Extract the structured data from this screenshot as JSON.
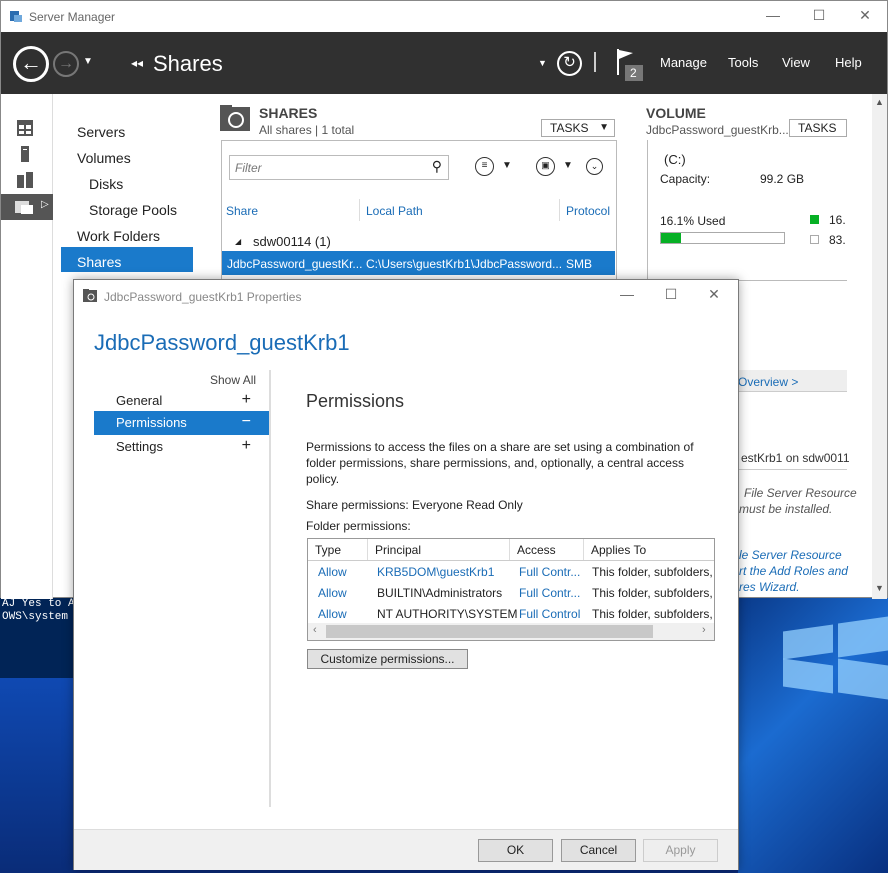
{
  "desktop": {
    "console_lines": [
      "AJ Yes to A",
      "OWS\\system"
    ]
  },
  "server_manager": {
    "title": "Server Manager",
    "breadcrumb": "Shares",
    "breadcrumb_arrows": "◂◂",
    "notification_count": "2",
    "menu": [
      "Manage",
      "Tools",
      "View",
      "Help"
    ],
    "nav_items": [
      "Servers",
      "Volumes",
      "Disks",
      "Storage Pools",
      "Work Folders",
      "Shares"
    ],
    "shares": {
      "heading": "SHARES",
      "subheading": "All shares | 1 total",
      "tasks_label": "TASKS",
      "filter_placeholder": "Filter",
      "columns": [
        "Share",
        "Local Path",
        "Protocol"
      ],
      "group_label": "sdw00114 (1)",
      "selected_row": {
        "share": "JdbcPassword_guestKr...",
        "local_path": "C:\\Users\\guestKrb1\\JdbcPassword...",
        "protocol": "SMB"
      }
    },
    "volume": {
      "heading": "VOLUME",
      "subheading": "JdbcPassword_guestKrb...",
      "tasks_label": "TASKS",
      "drive": "(C:)",
      "capacity_label": "Capacity:",
      "capacity_value": "99.2 GB",
      "used_label": "16.1% Used",
      "used_fraction": 0.161,
      "legend_used": "16.",
      "legend_free": "83.",
      "overview_link": "Overview >",
      "quota_text": "estKrb1 on sdw0011",
      "fsr_line1": "File Server Resource",
      "fsr_line2": "must be installed.",
      "wizard_line1": "le Server Resource",
      "wizard_line2": "rt the Add Roles and",
      "wizard_line3": "res Wizard."
    }
  },
  "dialog": {
    "title": "JdbcPassword_guestKrb1 Properties",
    "header": "JdbcPassword_guestKrb1",
    "show_all": "Show All",
    "sections": [
      {
        "label": "General",
        "sign": "+"
      },
      {
        "label": "Permissions",
        "sign": "−"
      },
      {
        "label": "Settings",
        "sign": "+"
      }
    ],
    "content_title": "Permissions",
    "description": "Permissions to access the files on a share are set using a combination of folder permissions, share permissions, and, optionally, a central access policy.",
    "share_permissions": "Share permissions: Everyone Read Only",
    "folder_permissions_label": "Folder permissions:",
    "table_headers": [
      "Type",
      "Principal",
      "Access",
      "Applies To"
    ],
    "table_rows": [
      {
        "type": "Allow",
        "principal": "KRB5DOM\\guestKrb1",
        "access": "Full Contr...",
        "applies": "This folder, subfolders,"
      },
      {
        "type": "Allow",
        "principal": "BUILTIN\\Administrators",
        "access": "Full Contr...",
        "applies": "This folder, subfolders,"
      },
      {
        "type": "Allow",
        "principal": "NT AUTHORITY\\SYSTEM",
        "access": "Full Control",
        "applies": "This folder, subfolders,"
      }
    ],
    "customize_button": "Customize permissions...",
    "ok_button": "OK",
    "cancel_button": "Cancel",
    "apply_button": "Apply"
  },
  "colors": {
    "accent": "#1a7acb",
    "topbar": "#303030",
    "used_bar": "#06b025"
  }
}
